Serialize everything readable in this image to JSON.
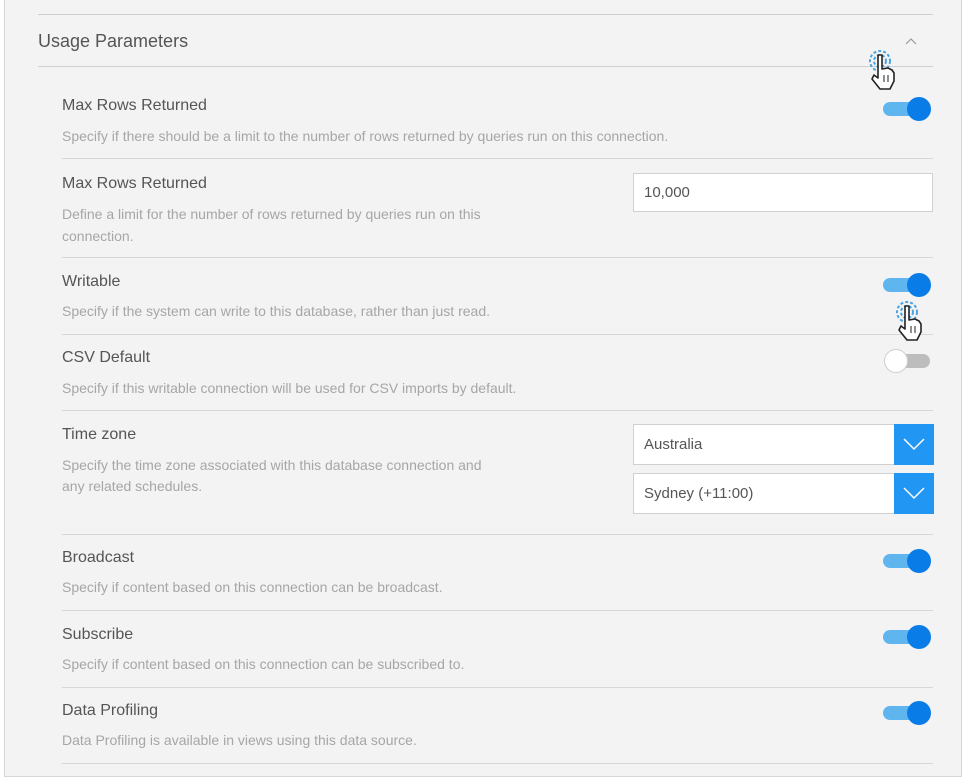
{
  "section": {
    "title": "Usage Parameters"
  },
  "rows": [
    {
      "title": "Max Rows Returned",
      "desc": "Specify if there should be a limit to the number of rows returned by queries run on this connection.",
      "toggle": true
    },
    {
      "title": "Max Rows Returned",
      "desc_line1": "Define a limit for the number of rows returned by queries run on this",
      "desc_line2": "connection.",
      "value": "10,000"
    },
    {
      "title": "Writable",
      "desc": "Specify if the system can write to this database, rather than just read.",
      "toggle": true
    },
    {
      "title": "CSV Default",
      "desc": "Specify if this writable connection will be used for CSV imports by default.",
      "toggle": false
    },
    {
      "title": "Time zone",
      "desc_line1": "Specify the time zone associated with this database connection and",
      "desc_line2": "any related schedules.",
      "region": "Australia",
      "city": "Sydney (+11:00)"
    },
    {
      "title": "Broadcast",
      "desc": "Specify if content based on this connection can be broadcast.",
      "toggle": true
    },
    {
      "title": "Subscribe",
      "desc": "Specify if content based on this connection can be subscribed to.",
      "toggle": true
    },
    {
      "title": "Data Profiling",
      "desc": "Data Profiling is available in views using this data source.",
      "toggle": true
    }
  ],
  "colors": {
    "accent": "#0a7ce8",
    "track_on": "#5fb6ee",
    "select_button": "#2196f3"
  }
}
